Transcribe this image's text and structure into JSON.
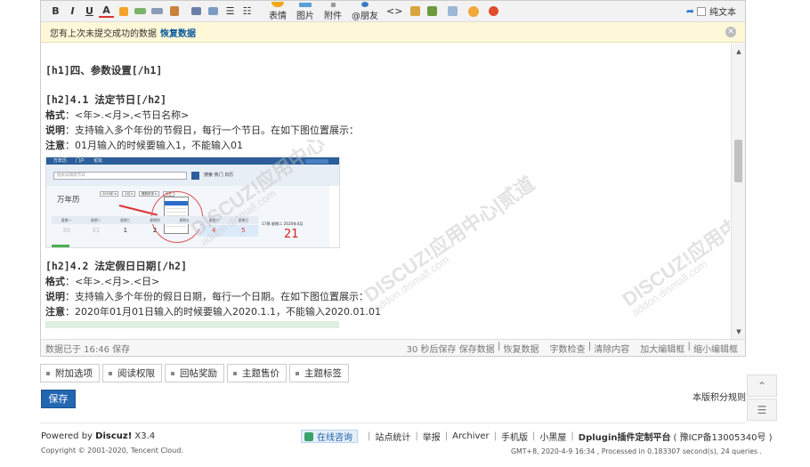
{
  "toolbar": {
    "small_buttons": [
      {
        "label": "B",
        "name": "bold-button"
      },
      {
        "label": "I",
        "name": "italic-button"
      },
      {
        "label": "U",
        "name": "underline-button"
      },
      {
        "label": "A",
        "name": "font-color-button"
      }
    ],
    "emoji_label": "表情",
    "image_label": "图片",
    "attach_label": "附件",
    "at_label": "@朋友",
    "plain_text_label": "纯文本"
  },
  "notice": {
    "text": "您有上次未提交成功的数据",
    "restore_label": "恢复数据"
  },
  "content": {
    "h1": "[h1]四、参数设置[/h1]",
    "s1_title": "[h2]4.1 法定节日[/h2]",
    "s1_format_key": "格式",
    "s1_format_val": "：<年>.<月>,<节日名称>",
    "s1_desc_key": "说明",
    "s1_desc_val": "：支持输入多个年份的节假日，每行一个节日。在如下图位置展示：",
    "s1_note_key": "注意",
    "s1_note_val": "：01月输入的时候要输入1，不能输入01",
    "s2_title": "[h2]4.2 法定假日日期[/h2]",
    "s2_format_key": "格式",
    "s2_format_val": "：<年>.<月>.<日>",
    "s2_desc_key": "说明",
    "s2_desc_val": "：支持输入多个年份的假日日期，每行一个日期。在如下图位置展示：",
    "s2_note_key": "注意",
    "s2_note_val": "：2020年01月01日输入的时候要输入2020.1.1，不能输入2020.01.01"
  },
  "embedded_image": {
    "brand": "万年历",
    "day_numbers": [
      "30",
      "31",
      "1",
      "2",
      "",
      "4",
      "5"
    ],
    "side_text": "17周 星期二 2020年4月",
    "big_number": "21"
  },
  "status": {
    "saved_text": "数据已于 16:46 保存",
    "autosave_text": "30 秒后保存",
    "save_data": "保存数据",
    "restore_data": "恢复数据",
    "word_check": "字数检查",
    "clear": "清除内容",
    "enlarge": "加大编辑框",
    "shrink": "缩小编辑框",
    "sep": "|"
  },
  "options": [
    "附加选项",
    "阅读权限",
    "回帖奖励",
    "主题售价",
    "主题标签"
  ],
  "save_label": "保存",
  "rules_label": "本版积分规则",
  "footer": {
    "powered_prefix": "Powered by ",
    "powered_brand": "Discuz!",
    "powered_version": " X3.4",
    "copyright": "Copyright © 2001-2020, Tencent Cloud.",
    "consult": "在线咨询",
    "links": [
      "站点统计",
      "举报",
      "Archiver",
      "手机版",
      "小黑屋"
    ],
    "platform": "Dplugin插件定制平台",
    "icp": "( 豫ICP备13005340号 )",
    "gmt": "GMT+8, 2020-4-9 16:34 , Processed in 0.183307 second(s), 24 queries ."
  },
  "colors": {
    "accent": "#2366b1",
    "notice_bg": "#fff8d8",
    "link": "#0a5a9c"
  }
}
